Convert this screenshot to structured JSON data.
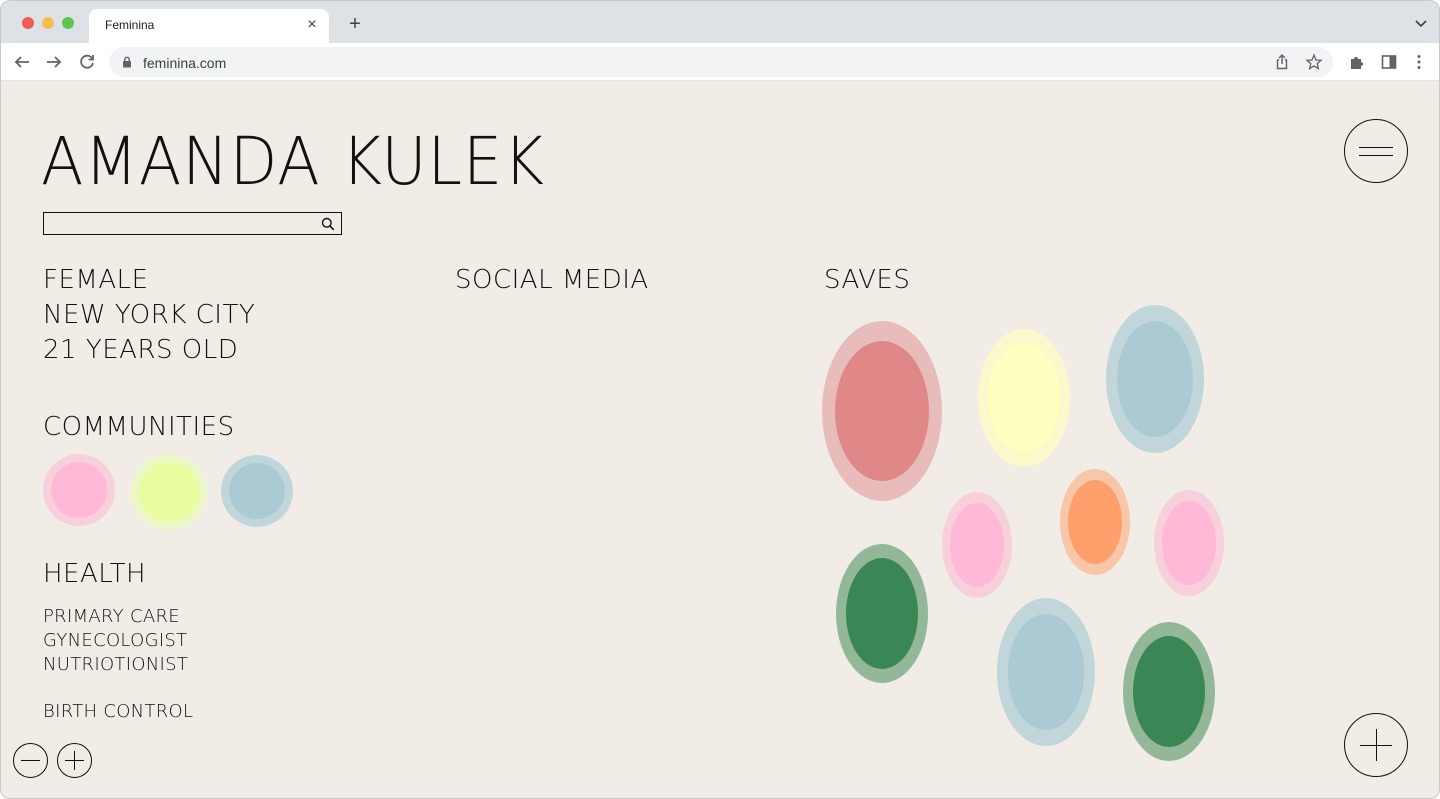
{
  "browser": {
    "tab_title": "Feminina",
    "url": "feminina.com",
    "close_glyph": "×",
    "new_tab_glyph": "+"
  },
  "profile": {
    "name": "AMANDA KULEK",
    "gender": "FEMALE",
    "city": "NEW YORK CITY",
    "age": "21 YEARS OLD"
  },
  "sections": {
    "communities": "COMMUNITIES",
    "social_media": "SOCIAL MEDIA",
    "saves": "SAVES",
    "health": "HEALTH"
  },
  "health_items": [
    "PRIMARY CARE",
    "GYNECOLOGIST",
    "NUTRIOTIONIST"
  ],
  "birth_control": "BIRTH CONTROL",
  "colors": {
    "background": "#f1ede6",
    "pink": "#ffb8d6",
    "lime": "#ecffa3",
    "blue": "#abcad4",
    "red": "#e08787",
    "yellow": "#ffffc0",
    "orange": "#ffa06c",
    "green": "#3a8654"
  }
}
